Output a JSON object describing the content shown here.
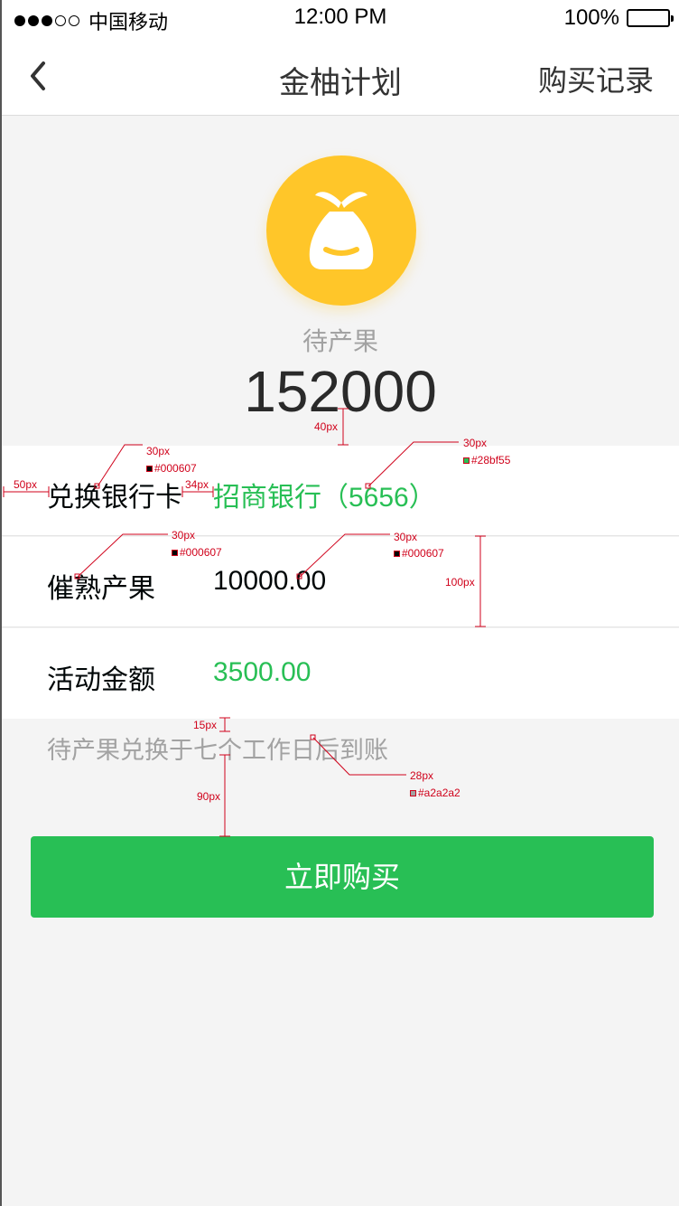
{
  "status_bar": {
    "carrier": "中国移动",
    "time": "12:00 PM",
    "battery": "100%"
  },
  "nav": {
    "title": "金柚计划",
    "action": "购买记录"
  },
  "hero": {
    "label": "待产果",
    "value": "152000"
  },
  "rows": [
    {
      "label": "兑换银行卡",
      "value": "招商银行（5656）"
    },
    {
      "label": "催熟产果",
      "value": "10000.00"
    },
    {
      "label": "活动金额",
      "value": "3500.00"
    }
  ],
  "notice": "待产果兑换于七个工作日后到账",
  "button": {
    "label": "立即购买"
  },
  "colors": {
    "primary_text": "#000607",
    "green": "#28bf55",
    "gray": "#a2a2a2",
    "gold": "#ffc629"
  },
  "annotations": {
    "gap_40": "40px",
    "left_50": "50px",
    "gap_34": "34px",
    "size_30": "30px",
    "color_dark": "#000607",
    "color_green": "#28bf55",
    "row_100": "100px",
    "gap_15": "15px",
    "gap_90": "90px",
    "size_28": "28px",
    "color_gray": "#a2a2a2"
  }
}
